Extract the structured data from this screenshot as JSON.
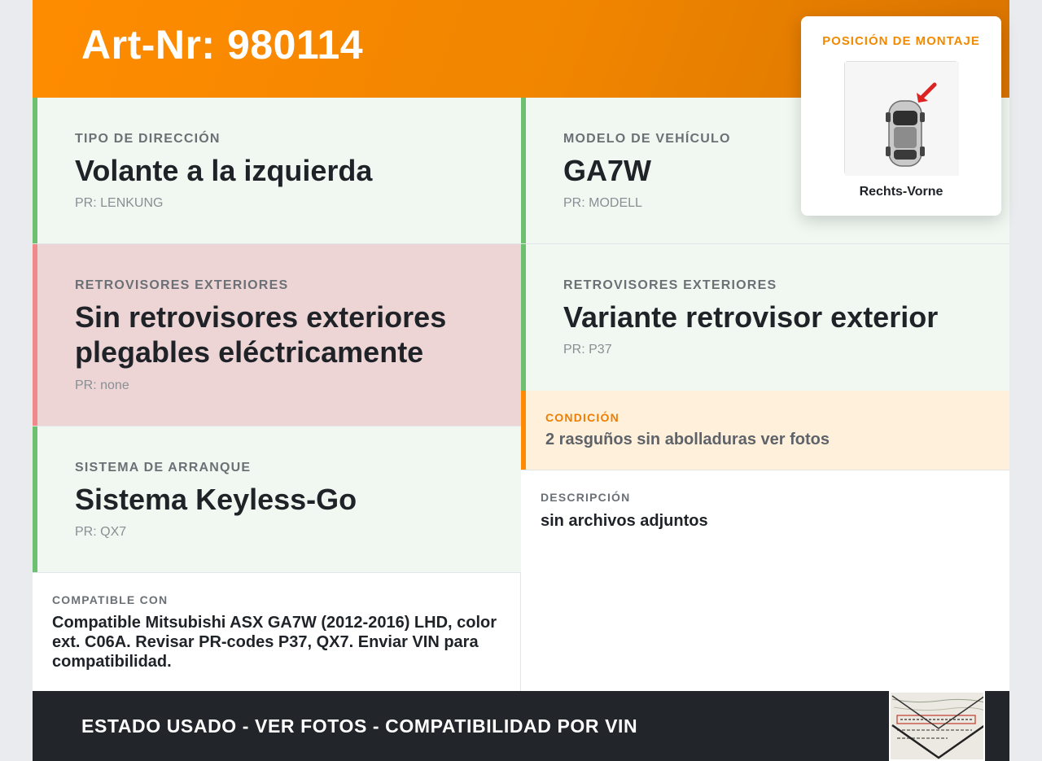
{
  "header": {
    "title": "Art-Nr: 980114"
  },
  "cells": [
    {
      "label": "TIPO DE DIRECCIÓN",
      "value": "Volante a la izquierda",
      "pr": "PR: LENKUNG",
      "status": "ok"
    },
    {
      "label": "MODELO DE VEHÍCULO",
      "value": "GA7W",
      "pr": "PR: MODELL",
      "status": "ok"
    },
    {
      "label": "RETROVISORES EXTERIORES",
      "value": "Sin retrovisores exteriores plegables eléctricamente",
      "pr": "PR: none",
      "status": "missing"
    },
    {
      "label": "RETROVISORES EXTERIORES",
      "value": "Variante retrovisor exterior",
      "pr": "PR: P37",
      "status": "ok"
    },
    {
      "label": "SISTEMA DE ARRANQUE",
      "value": "Sistema Keyless-Go",
      "pr": "PR: QX7",
      "status": "ok"
    }
  ],
  "condition": {
    "label": "CONDICIÓN",
    "text": "2 rasguños sin abolladuras ver fotos"
  },
  "description": {
    "label": "DESCRIPCIÓN",
    "text": "sin archivos adjuntos"
  },
  "compatible": {
    "label": "COMPATIBLE CON",
    "text": "Compatible Mitsubishi ASX GA7W (2012-2016) LHD, color ext. C06A. Revisar PR-codes P37, QX7. Enviar VIN para compatibilidad."
  },
  "mount": {
    "title": "POSICIÓN DE MONTAJE",
    "caption": "Rechts-Vorne"
  },
  "footer": {
    "slogan": "ESTADO USADO - VER FOTOS - COMPATIBILIDAD POR VIN"
  },
  "colors": {
    "accent": "#ff8c00",
    "ok": "#6cc070",
    "missing": "#f08a8a",
    "footer": "#22262b"
  },
  "icons": {
    "mount_arrow": "red-arrow-icon",
    "car": "car-top-view-icon",
    "thumbnail": "document-photo-thumbnail"
  }
}
